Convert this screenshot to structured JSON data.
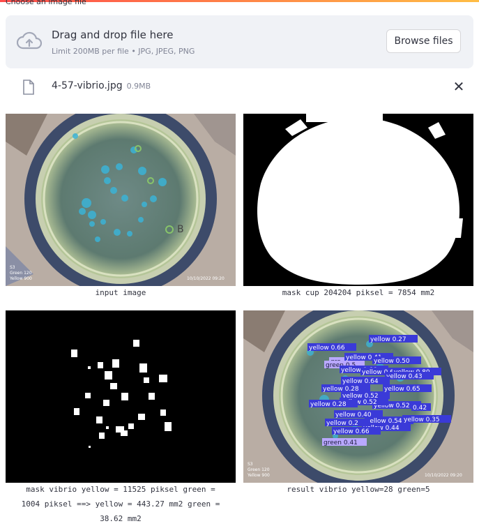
{
  "uploader": {
    "label": "Choose an image file",
    "drop_title": "Drag and drop file here",
    "limit_text": "Limit 200MB per file • JPG, JPEG, PNG",
    "browse_label": "Browse files",
    "icon": "cloud-upload-icon"
  },
  "file": {
    "name": "4-57-vibrio.jpg",
    "size": "0.9MB",
    "icon": "file-icon",
    "close_icon": "close-icon",
    "close_glyph": "✕"
  },
  "images": [
    {
      "caption": "input image"
    },
    {
      "caption": "mask cup 204204 piksel = 7854 mm2"
    },
    {
      "caption_lines": [
        "mask vibrio yellow = 11525 piksel green =",
        "1004 piksel ==> yellow = 443.27 mm2 green =",
        "38.62 mm2"
      ]
    },
    {
      "caption": "result vibrio yellow=28 green=5"
    }
  ],
  "photo_overlay": {
    "lines": [
      "S3",
      "Green 120",
      "Yellow 900"
    ],
    "date": "10/10/2022 09:20"
  },
  "detections": [
    {
      "label": "yellow 0.27"
    },
    {
      "label": "yellow 0.66"
    },
    {
      "label": "yellow 0.41"
    },
    {
      "label": "gre"
    },
    {
      "label": "green 0.5"
    },
    {
      "label": "yellow 0.66"
    },
    {
      "label": "yellow 0.50"
    },
    {
      "label": "yellow 0.61"
    },
    {
      "label": "yellow 0.80"
    },
    {
      "label": "yellow 0.43"
    },
    {
      "label": "yellow 0.64"
    },
    {
      "label": "yellow 0.28"
    },
    {
      "label": "yellow 0.52"
    },
    {
      "label": "yellow 0.65"
    },
    {
      "label": "yellow 0.52"
    },
    {
      "label": "yellow 0.52"
    },
    {
      "label": "yellow 0.28"
    },
    {
      "label": "0.42"
    },
    {
      "label": "yellow 0.40"
    },
    {
      "label": "yellow 0.54"
    },
    {
      "label": "yellow 0.35"
    },
    {
      "label": "yellow 0.2"
    },
    {
      "label": "yellow 0.44"
    },
    {
      "label": "yellow 0.66"
    },
    {
      "label": "green 0.41"
    }
  ],
  "colors": {
    "accent": "#ff4b4b",
    "dropzone_bg": "#f0f2f6",
    "box_yellow": "#3a3ad8",
    "box_green": "#b9a8ff"
  }
}
